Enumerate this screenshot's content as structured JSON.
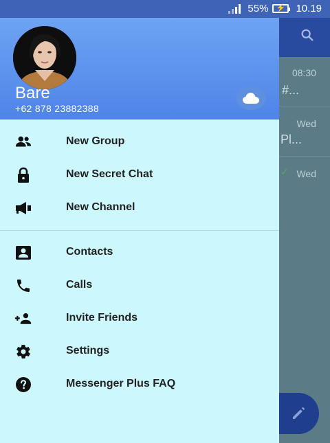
{
  "status_bar": {
    "battery": "55%",
    "time": "10.19"
  },
  "background_chats": [
    {
      "time": "08:30",
      "snippet": "#..."
    },
    {
      "time": "Wed",
      "snippet": "Pl..."
    },
    {
      "time": "Wed",
      "snippet": ""
    }
  ],
  "drawer": {
    "user": {
      "name": "Bare",
      "phone": "+62 878 23882388"
    },
    "menu": [
      {
        "label": "New Group",
        "icon": "group-icon"
      },
      {
        "label": "New Secret Chat",
        "icon": "lock-icon"
      },
      {
        "label": "New Channel",
        "icon": "megaphone-icon"
      },
      {
        "label": "Contacts",
        "icon": "contact-card-icon"
      },
      {
        "label": "Calls",
        "icon": "phone-icon"
      },
      {
        "label": "Invite Friends",
        "icon": "add-person-icon"
      },
      {
        "label": "Settings",
        "icon": "gear-icon"
      },
      {
        "label": "Messenger Plus FAQ",
        "icon": "help-icon"
      }
    ]
  },
  "colors": {
    "drawer_bg": "#ccf7fd",
    "header_gradient_top": "#6ea3f3",
    "header_gradient_bottom": "#4f84e8",
    "status_bar": "#3f64b5",
    "app_toolbar": "#284a9f",
    "fab": "#1f3f8e"
  }
}
